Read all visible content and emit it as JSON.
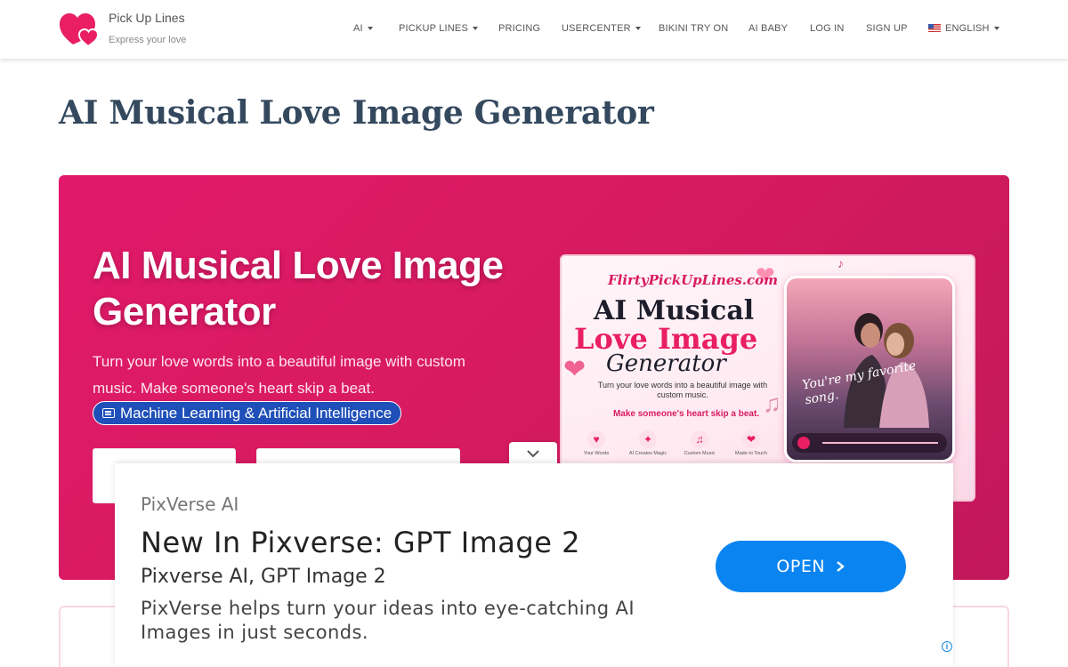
{
  "brand": {
    "name": "Pick Up Lines",
    "tagline": "Express your love",
    "color": "#e91e63"
  },
  "nav": {
    "items": [
      {
        "label": "AI",
        "dropdown": true
      },
      {
        "label": "PICKUP LINES",
        "dropdown": true
      },
      {
        "label": "PRICING",
        "dropdown": false
      },
      {
        "label": "USERCENTER",
        "dropdown": true
      },
      {
        "label": "BIKINI TRY ON",
        "dropdown": false
      },
      {
        "label": "AI BABY",
        "dropdown": false
      },
      {
        "label": "LOG IN",
        "dropdown": false
      },
      {
        "label": "SIGN UP",
        "dropdown": false
      },
      {
        "label": "ENGLISH",
        "dropdown": true,
        "icon": "us-flag-icon"
      }
    ]
  },
  "page": {
    "title": "AI Musical Love Image Generator"
  },
  "hero": {
    "title": "AI Musical Love Image Generator",
    "description": "Turn your love words into a beautiful image with custom music. Make someone's heart skip a beat.",
    "category": "Machine Learning & Artificial Intelligence",
    "accent": "#d81b60",
    "badge_color": "#1f4fb8"
  },
  "promo": {
    "site": "FlirtyPickUpLines.com",
    "title_line1": "AI Musical",
    "title_line2": "Love Image",
    "title_line3": "Generator",
    "subtitle": "Turn your love words into a beautiful image with custom music.",
    "tagline": "Make someone's heart skip a beat.",
    "quote": "You're my favorite song.",
    "features": [
      "Your Words",
      "AI Creates Magic",
      "Custom Music",
      "Made to Touch"
    ]
  },
  "ad": {
    "source": "PixVerse AI",
    "headline": "New In Pixverse: GPT Image 2",
    "subline": "Pixverse AI, GPT Image 2",
    "body": "PixVerse helps turn your ideas into eye-catching AI Images in just seconds.",
    "cta": "OPEN",
    "cta_color": "#0a84f0"
  }
}
